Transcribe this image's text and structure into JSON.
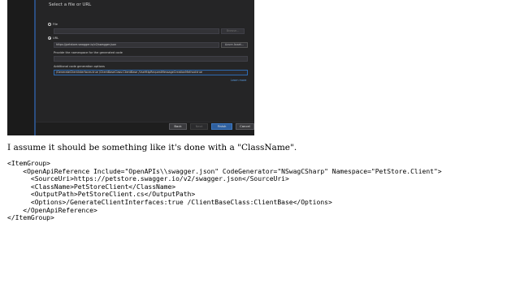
{
  "dialog": {
    "title": "Select a file or URL",
    "file_option_label": "File",
    "file_path_value": "",
    "browse_label": "Browse...",
    "url_option_label": "URL",
    "url_value": "https://petstore.swagger.io/v2/swagger.json",
    "azure_asset_label": "Azure Asset...",
    "namespace_label": "Provide the namespace for the generated code",
    "namespace_value": "",
    "options_label": "Additional code generation options",
    "options_value": "/GenerateClientInterfaces:true /ClientBaseClass:ClientBase /UseHttpRequestMessageCreationMethod:true",
    "learn_more_label": "Learn more",
    "selected_option": "URL",
    "buttons": {
      "back": "Back",
      "next": "Next",
      "finish": "Finish",
      "cancel": "Cancel"
    }
  },
  "post": {
    "paragraph": "I assume it should be something like it's done with a \"ClassName\".",
    "code_lines": [
      "<ItemGroup>",
      "    <OpenApiReference Include=\"OpenAPIs\\\\swagger.json\" CodeGenerator=\"NSwagCSharp\" Namespace=\"PetStore.Client\">",
      "      <SourceUri>https://petstore.swagger.io/v2/swagger.json</SourceUri>",
      "      <ClassName>PetStoreClient</ClassName>",
      "      <OutputPath>PetStoreClient.cs</OutputPath>",
      "      <Options>/GenerateClientInterfaces:true /ClientBaseClass:ClientBase</Options>",
      "    </OpenApiReference>",
      "</ItemGroup>"
    ]
  },
  "colors": {
    "dialog_background": "#252526",
    "accent_blue": "#2e5f9e",
    "link_blue": "#5aa0e6"
  }
}
